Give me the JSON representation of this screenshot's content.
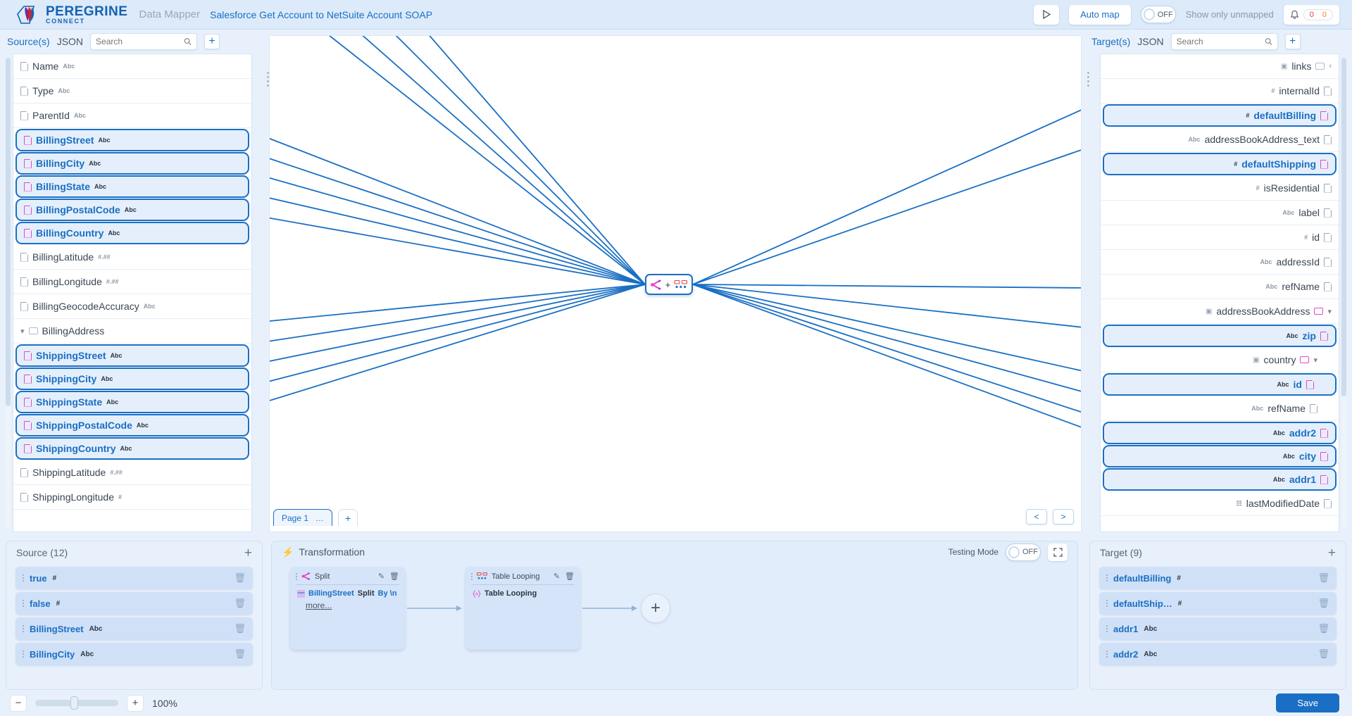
{
  "header": {
    "brand_main": "PEREGRINE",
    "brand_sub": "CONNECT",
    "app_name": "Data Mapper",
    "doc_title": "Salesforce Get Account to NetSuite Account SOAP",
    "run_icon": "play-icon",
    "auto_map_label": "Auto map",
    "unmapped_toggle_value": "OFF",
    "unmapped_label": "Show only unmapped",
    "bell_icon": "bell-icon",
    "error_count": "0",
    "warning_count": "0"
  },
  "source_panel": {
    "title": "Source(s)",
    "kind": "JSON",
    "search_placeholder": "Search",
    "search_value": "",
    "add_label": "+",
    "nodes": [
      {
        "label": "Name",
        "type": "Abc",
        "mapped": false,
        "kind": "field"
      },
      {
        "label": "Type",
        "type": "Abc",
        "mapped": false,
        "kind": "field"
      },
      {
        "label": "ParentId",
        "type": "Abc",
        "mapped": false,
        "kind": "field"
      },
      {
        "label": "BillingStreet",
        "type": "Abc",
        "mapped": true,
        "kind": "field"
      },
      {
        "label": "BillingCity",
        "type": "Abc",
        "mapped": true,
        "kind": "field"
      },
      {
        "label": "BillingState",
        "type": "Abc",
        "mapped": true,
        "kind": "field"
      },
      {
        "label": "BillingPostalCode",
        "type": "Abc",
        "mapped": true,
        "kind": "field"
      },
      {
        "label": "BillingCountry",
        "type": "Abc",
        "mapped": true,
        "kind": "field"
      },
      {
        "label": "BillingLatitude",
        "type": "#.##",
        "mapped": false,
        "kind": "field"
      },
      {
        "label": "BillingLongitude",
        "type": "#.##",
        "mapped": false,
        "kind": "field"
      },
      {
        "label": "BillingGeocodeAccuracy",
        "type": "Abc",
        "mapped": false,
        "kind": "field"
      },
      {
        "label": "BillingAddress",
        "type": "",
        "mapped": false,
        "kind": "group"
      },
      {
        "label": "ShippingStreet",
        "type": "Abc",
        "mapped": true,
        "kind": "field"
      },
      {
        "label": "ShippingCity",
        "type": "Abc",
        "mapped": true,
        "kind": "field"
      },
      {
        "label": "ShippingState",
        "type": "Abc",
        "mapped": true,
        "kind": "field"
      },
      {
        "label": "ShippingPostalCode",
        "type": "Abc",
        "mapped": true,
        "kind": "field"
      },
      {
        "label": "ShippingCountry",
        "type": "Abc",
        "mapped": true,
        "kind": "field"
      },
      {
        "label": "ShippingLatitude",
        "type": "#.##",
        "mapped": false,
        "kind": "field"
      },
      {
        "label": "ShippingLongitude",
        "type": "#",
        "mapped": false,
        "kind": "field"
      }
    ]
  },
  "target_panel": {
    "title": "Target(s)",
    "kind": "JSON",
    "search_placeholder": "Search",
    "search_value": "",
    "add_label": "+",
    "nodes": [
      {
        "label": "links",
        "type": "",
        "mapped": false,
        "kind": "group",
        "collapsed": true,
        "indent": 0
      },
      {
        "label": "internalId",
        "type": "#",
        "mapped": false,
        "kind": "field",
        "indent": 0
      },
      {
        "label": "defaultBilling",
        "type": "#",
        "mapped": true,
        "kind": "field",
        "indent": 0
      },
      {
        "label": "addressBookAddress_text",
        "type": "Abc",
        "mapped": false,
        "kind": "field",
        "indent": 0
      },
      {
        "label": "defaultShipping",
        "type": "#",
        "mapped": true,
        "kind": "field",
        "indent": 0
      },
      {
        "label": "isResidential",
        "type": "#",
        "mapped": false,
        "kind": "field",
        "indent": 0
      },
      {
        "label": "label",
        "type": "Abc",
        "mapped": false,
        "kind": "field",
        "indent": 0
      },
      {
        "label": "id",
        "type": "#",
        "mapped": false,
        "kind": "field",
        "indent": 0
      },
      {
        "label": "addressId",
        "type": "Abc",
        "mapped": false,
        "kind": "field",
        "indent": 0
      },
      {
        "label": "refName",
        "type": "Abc",
        "mapped": false,
        "kind": "field",
        "indent": 0
      },
      {
        "label": "addressBookAddress",
        "type": "",
        "mapped": false,
        "kind": "group",
        "collapsed": false,
        "indent": 0
      },
      {
        "label": "zip",
        "type": "Abc",
        "mapped": true,
        "kind": "field",
        "indent": 0
      },
      {
        "label": "country",
        "type": "",
        "mapped": false,
        "kind": "group",
        "collapsed": false,
        "indent": 1
      },
      {
        "label": "id",
        "type": "Abc",
        "mapped": true,
        "kind": "field",
        "indent": 1
      },
      {
        "label": "refName",
        "type": "Abc",
        "mapped": false,
        "kind": "field",
        "indent": 1
      },
      {
        "label": "addr2",
        "type": "Abc",
        "mapped": true,
        "kind": "field",
        "indent": 0
      },
      {
        "label": "city",
        "type": "Abc",
        "mapped": true,
        "kind": "field",
        "indent": 0
      },
      {
        "label": "addr1",
        "type": "Abc",
        "mapped": true,
        "kind": "field",
        "indent": 0
      },
      {
        "label": "lastModifiedDate",
        "type": "date",
        "mapped": false,
        "kind": "field",
        "indent": 0
      }
    ]
  },
  "canvas": {
    "map_node_icons": [
      "split-icon",
      "plus-sign",
      "table-looping-icon"
    ],
    "page_tab_label": "Page 1",
    "page_tab_menu": "…",
    "page_add_label": "+",
    "prev_label": "<",
    "next_label": ">",
    "link_color": "#1a6fc4"
  },
  "bottom_source": {
    "title": "Source (12)",
    "add_label": "+",
    "items": [
      {
        "name": "true",
        "type": "#"
      },
      {
        "name": "false",
        "type": "#"
      },
      {
        "name": "BillingStreet",
        "type": "Abc"
      },
      {
        "name": "BillingCity",
        "type": "Abc"
      }
    ]
  },
  "bottom_target": {
    "title": "Target (9)",
    "add_label": "+",
    "items": [
      {
        "name": "defaultBilling",
        "type": "#"
      },
      {
        "name": "defaultShip…",
        "type": "#"
      },
      {
        "name": "addr1",
        "type": "Abc"
      },
      {
        "name": "addr2",
        "type": "Abc"
      }
    ]
  },
  "transformation": {
    "title": "Transformation",
    "testing_mode_label": "Testing Mode",
    "testing_mode_value": "OFF",
    "expand_icon": "fullscreen-icon",
    "cards": [
      {
        "title": "Split",
        "icon": "split-icon",
        "row_field": "BillingStreet",
        "row_op": "Split",
        "row_arg": "By \\n",
        "more_label": "more..."
      },
      {
        "title": "Table Looping",
        "icon": "table-looping-icon",
        "row_field": "Table Looping",
        "row_op": "",
        "row_arg": "",
        "more_label": ""
      }
    ],
    "add_label": "+"
  },
  "footer": {
    "zoom_out_label": "−",
    "zoom_in_label": "+",
    "zoom_value": "100%",
    "save_label": "Save"
  }
}
